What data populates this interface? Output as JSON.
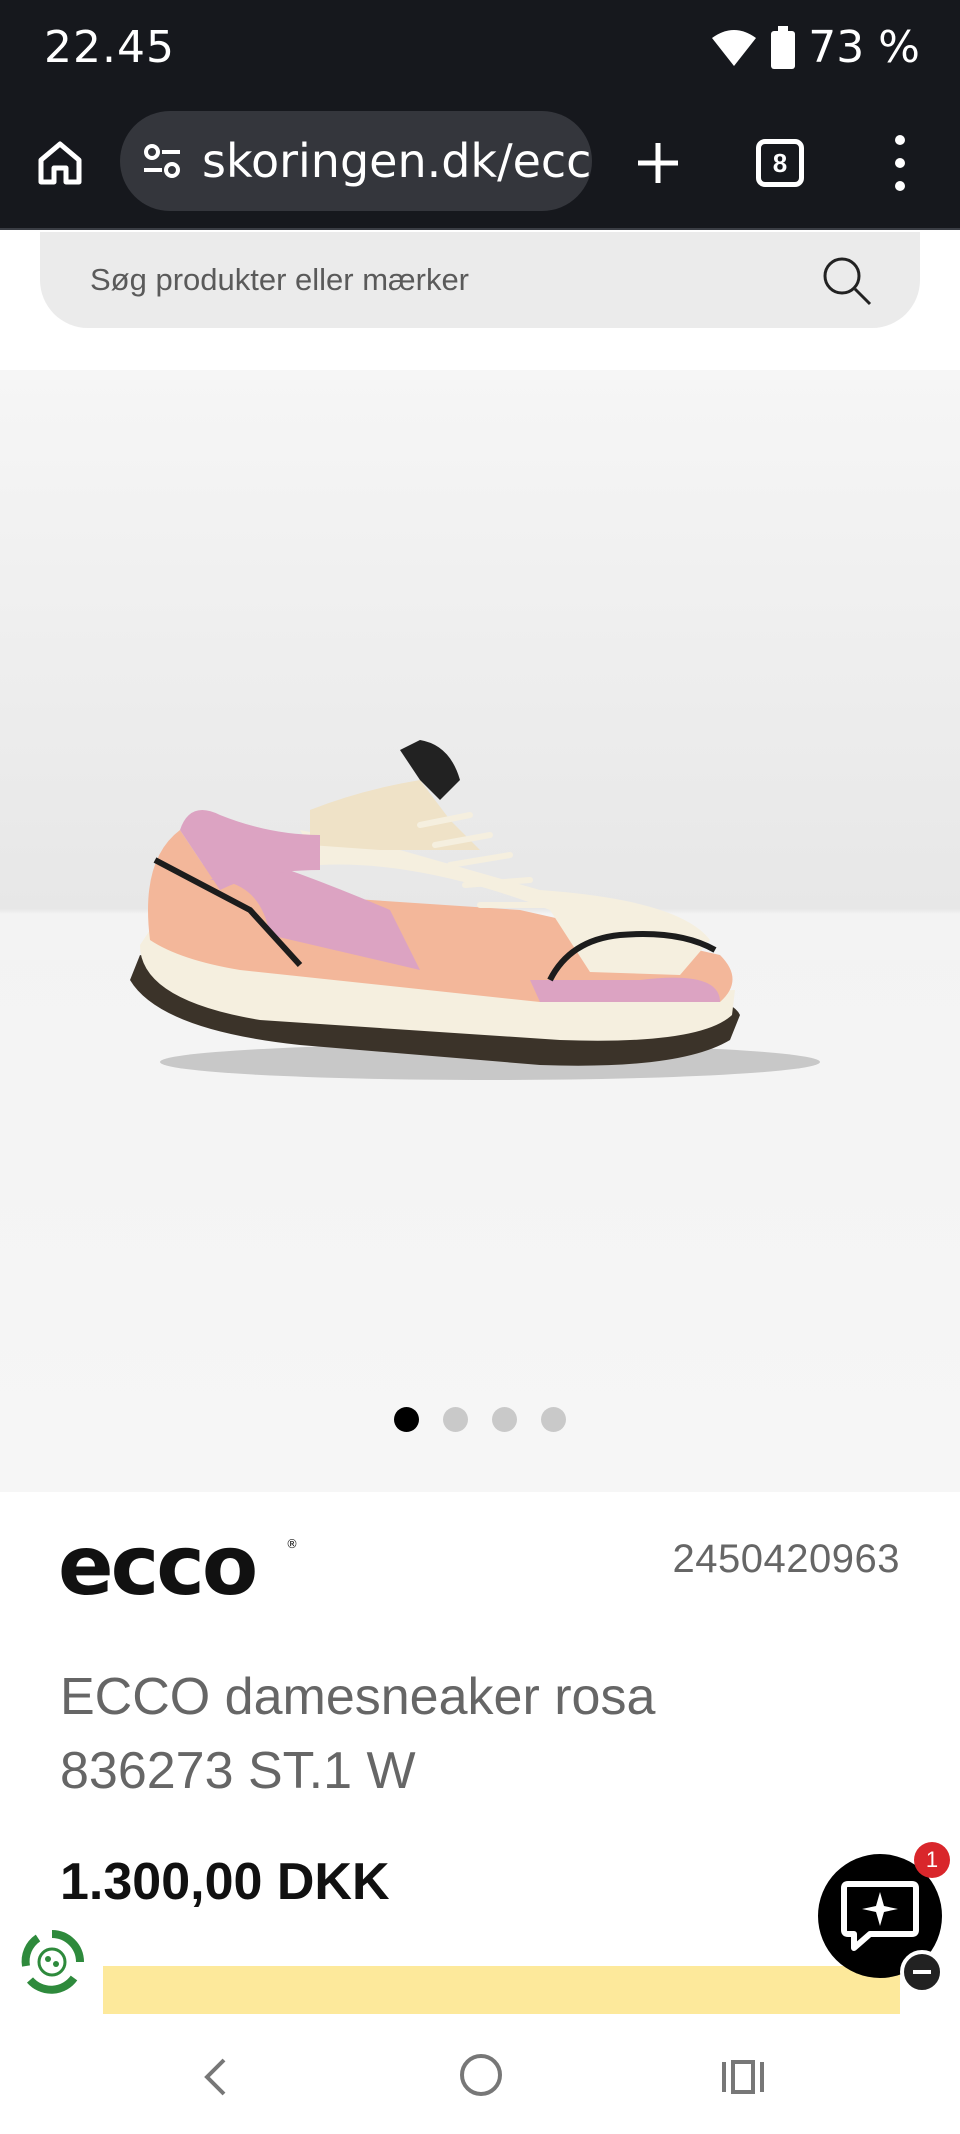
{
  "status": {
    "time": "22.45",
    "battery": "73 %"
  },
  "browser": {
    "url": "skoringen.dk/ecc",
    "tab_count": "8"
  },
  "search": {
    "placeholder": "Søg produkter eller mærker"
  },
  "gallery": {
    "image_count": 4,
    "active_index": 0
  },
  "product": {
    "brand": "ecco",
    "sku": "2450420963",
    "title": "ECCO damesneaker rosa 836273 ST.1 W",
    "price": "1.300,00 DKK"
  },
  "chat": {
    "badge_count": "1"
  },
  "icons": {
    "home": "home-icon",
    "site_settings": "tune-icon",
    "new_tab": "plus-icon",
    "menu": "more-vert-icon",
    "search": "search-icon",
    "chat": "chat-sparkle-icon",
    "eco": "recycle-badge-icon",
    "nav_back": "back-icon",
    "nav_home": "circle-home-icon",
    "nav_recent": "recents-icon"
  },
  "colors": {
    "cta": "#fde99b",
    "chat_badge": "#d9262b",
    "chrome": "#16181d"
  }
}
